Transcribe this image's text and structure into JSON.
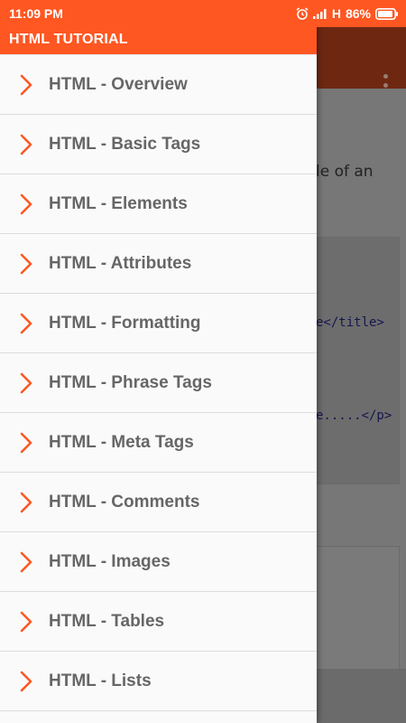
{
  "status_bar": {
    "time": "11:09 PM",
    "network": "H",
    "battery": "86%"
  },
  "drawer": {
    "title": "HTML TUTORIAL",
    "items": [
      {
        "label": "HTML - Overview"
      },
      {
        "label": "HTML - Basic Tags"
      },
      {
        "label": "HTML - Elements"
      },
      {
        "label": "HTML - Attributes"
      },
      {
        "label": "HTML - Formatting"
      },
      {
        "label": "HTML - Phrase Tags"
      },
      {
        "label": "HTML - Meta Tags"
      },
      {
        "label": "HTML - Comments"
      },
      {
        "label": "HTML - Images"
      },
      {
        "label": "HTML - Tables"
      },
      {
        "label": "HTML - Lists"
      }
    ]
  },
  "background": {
    "text_fragment": "le of an",
    "code_line_1": "e</title>",
    "code_line_2": "e.....</p>"
  },
  "colors": {
    "accent": "#ff5722",
    "chevron": "#ff5722",
    "item_text": "#666666"
  },
  "icons": {
    "alarm": "alarm-clock-icon",
    "signal": "signal-bars-icon",
    "battery": "battery-icon",
    "item": "chevron-right-icon",
    "overflow": "more-vert-icon"
  }
}
